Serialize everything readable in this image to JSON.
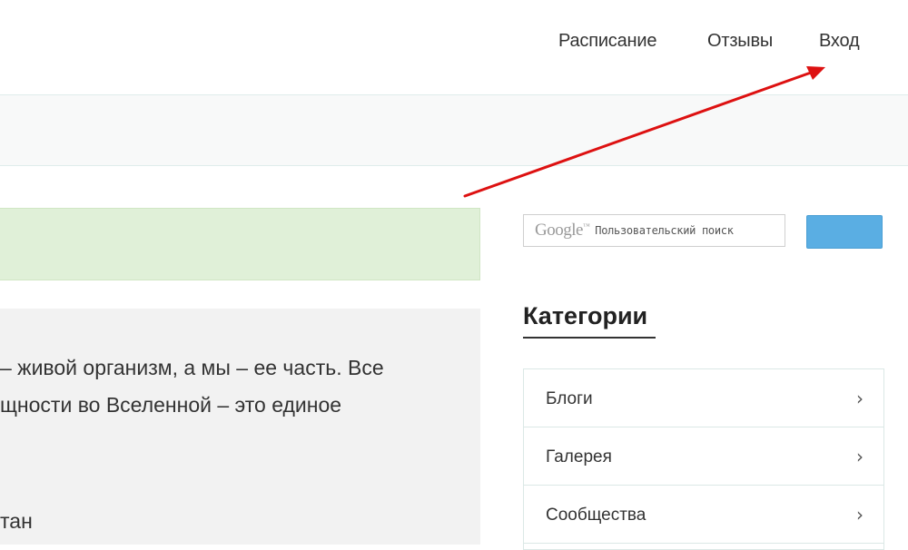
{
  "nav": {
    "items": [
      {
        "label": "Расписание"
      },
      {
        "label": "Отзывы"
      },
      {
        "label": "Вход"
      }
    ]
  },
  "content": {
    "lines": [
      "– живой организм, а мы – ее часть. Все",
      "щности во Вселенной – это единое",
      "тан"
    ]
  },
  "search": {
    "logo_text": "Google",
    "logo_tm": "™",
    "placeholder": "Пользовательский поиск",
    "button_label": ""
  },
  "categories": {
    "title": "Категории",
    "items": [
      {
        "label": "Блоги"
      },
      {
        "label": "Галерея"
      },
      {
        "label": "Сообщества"
      }
    ]
  },
  "annotation": {
    "arrow_color": "#dd1111"
  },
  "colors": {
    "alert_green": "#e0f0d8",
    "search_button": "#5aaee3",
    "content_bg": "#f2f2f2"
  }
}
